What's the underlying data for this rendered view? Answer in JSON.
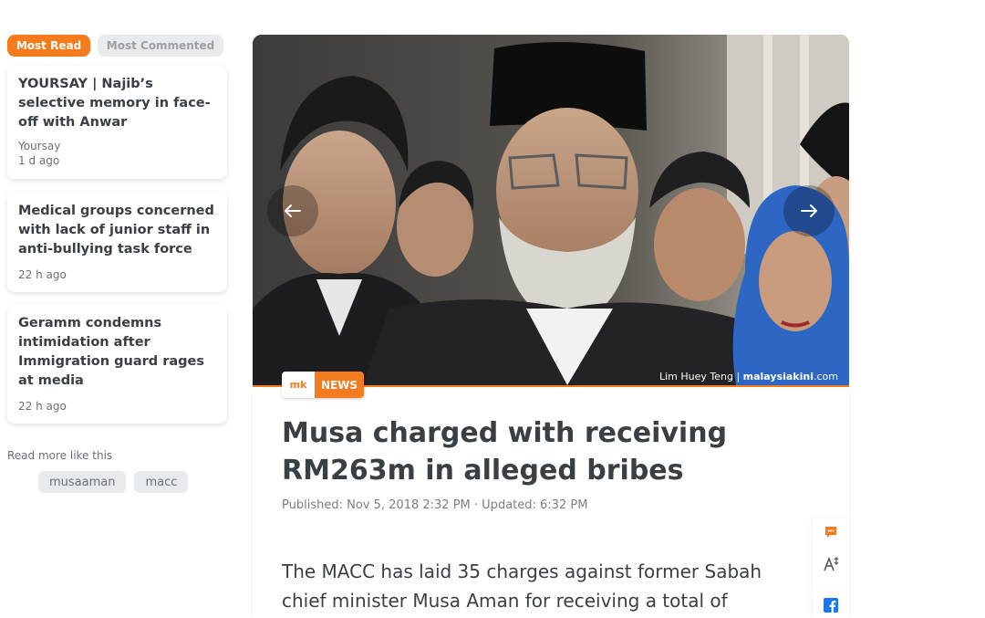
{
  "sidebar": {
    "tabs": [
      {
        "label": "Most Read"
      },
      {
        "label": "Most Commented"
      }
    ],
    "cards": [
      {
        "title": "YOURSAY | Najib’s selective memory in face-off with Anwar",
        "source": "Yoursay",
        "time": "1 d ago"
      },
      {
        "title": "Medical groups concerned with lack of junior staff in anti-bullying task force",
        "time": "22 h ago"
      },
      {
        "title": "Geramm condemns intimidation after Immigration guard rages at media",
        "time": "22 h ago"
      }
    ],
    "read_more": "Read more like this",
    "tags": [
      "musaaman",
      "macc"
    ]
  },
  "article": {
    "photo_credit_name": "Lim Huey Teng",
    "photo_credit_sep": " | ",
    "photo_credit_site": "malaysiakini",
    "photo_credit_tld": ".com",
    "badge_logo": "mk",
    "badge_label": "NEWS",
    "headline": "Musa charged with receiving RM263m in alleged bribes",
    "published_label": "Published:",
    "published": "Nov 5, 2018 2:32 PM",
    "sep": "·",
    "updated_label": "Updated:",
    "updated": "6:32 PM",
    "lead": "The MACC has laid 35 charges against former Sabah chief minister Musa Aman for receiving a total of"
  },
  "icons": {
    "prev": "arrow-left-icon",
    "next": "arrow-right-icon",
    "comment": "comment-icon",
    "font_size": "font-size-icon",
    "facebook": "facebook-icon"
  },
  "colors": {
    "accent": "#f47c1e",
    "text": "#3a3f44",
    "muted": "#7a7f84",
    "facebook": "#1877f2"
  }
}
